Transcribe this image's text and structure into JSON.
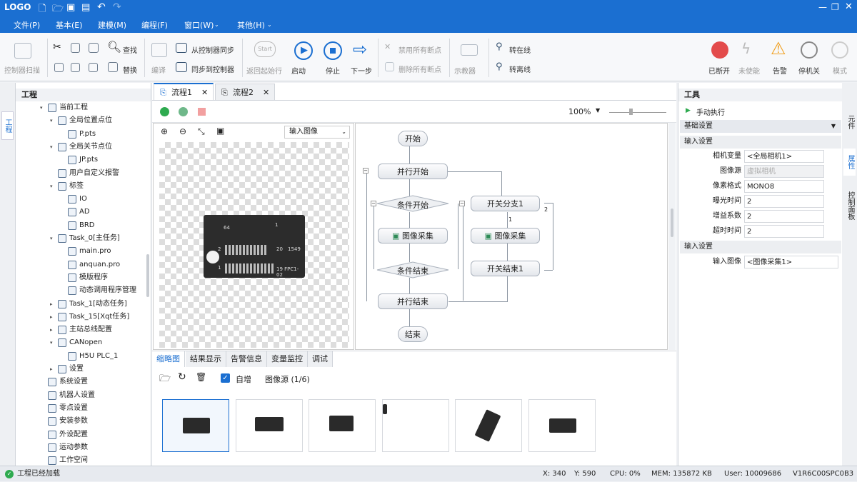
{
  "app": {
    "logo": "LOGO"
  },
  "menu": [
    "文件(P)",
    "基本(E)",
    "建模(M)",
    "编程(F)",
    "窗口(W)",
    "其他(H)"
  ],
  "ribbon": {
    "scan": "控制器扫描",
    "find": "查找",
    "replace": "替换",
    "compile": "编译",
    "sync_from": "从控制器同步",
    "sync_to": "同步到控制器",
    "start_icon_text": "Start",
    "back_start": "返回起始行",
    "run": "启动",
    "stop": "停止",
    "next": "下一步",
    "disable_bp": "禁用所有断点",
    "delete_bp": "删除所有断点",
    "teach": "示教器",
    "online": "转在线",
    "offline": "转离线",
    "disconnected": "已断开",
    "not_enabled": "未使能",
    "alarm": "告警",
    "stopped": "停机关",
    "mode": "模式"
  },
  "left_panel": {
    "title": "工程",
    "strip_label": "工程",
    "tree": [
      {
        "label": "当前工程",
        "level": 0
      },
      {
        "label": "全局位置点位",
        "level": 1
      },
      {
        "label": "P.pts",
        "level": 2
      },
      {
        "label": "全局关节点位",
        "level": 1
      },
      {
        "label": "JP.pts",
        "level": 2
      },
      {
        "label": "用户自定义报警",
        "level": 1
      },
      {
        "label": "标签",
        "level": 1
      },
      {
        "label": "IO",
        "level": 2
      },
      {
        "label": "AD",
        "level": 2
      },
      {
        "label": "BRD",
        "level": 2
      },
      {
        "label": "Task_0[主任务]",
        "level": 1
      },
      {
        "label": "main.pro",
        "level": 2
      },
      {
        "label": "anquan.pro",
        "level": 2
      },
      {
        "label": "模版程序",
        "level": 2
      },
      {
        "label": "动态调用程序管理",
        "level": 2
      },
      {
        "label": "Task_1[动态任务]",
        "level": 1
      },
      {
        "label": "Task_15[Xqt任务]",
        "level": 1
      },
      {
        "label": "主站总线配置",
        "level": 1
      },
      {
        "label": "CANopen",
        "level": 1
      },
      {
        "label": "H5U PLC_1",
        "level": 2
      },
      {
        "label": "设置",
        "level": 1
      },
      {
        "label": "系统设置",
        "level": 0
      },
      {
        "label": "机器人设置",
        "level": 0
      },
      {
        "label": "零点设置",
        "level": 0
      },
      {
        "label": "安装参数",
        "level": 0
      },
      {
        "label": "外设配置",
        "level": 0
      },
      {
        "label": "运动参数",
        "level": 0
      },
      {
        "label": "工作空间",
        "level": 0
      }
    ]
  },
  "tabs": [
    "流程1",
    "流程2"
  ],
  "zoom": "100%",
  "image_select": "输入图像",
  "board": {
    "n64": "64",
    "n1a": "1",
    "n2": "2",
    "n1b": "1",
    "n20": "20",
    "n1549": "1549",
    "code": "19 FPC1-02"
  },
  "flow": {
    "start": "开始",
    "parallel_start": "并行开始",
    "cond_start": "条件开始",
    "switch": "开关分支1",
    "capture1": "图像采集",
    "capture2": "图像采集",
    "cond_end": "条件结束",
    "switch_end": "开关结束1",
    "parallel_end": "并行结束",
    "end": "结束",
    "lbl1": "1",
    "lbl2": "2"
  },
  "bottom": {
    "tabs": [
      "缩略图",
      "结果显示",
      "告警信息",
      "变量监控",
      "调试"
    ],
    "auto_inc": "自增",
    "image_source": "图像源  (1/6)"
  },
  "right_panel": {
    "title": "工具",
    "manual": "手动执行",
    "basic": "基础设置",
    "input_settings": "输入设置",
    "input_settings2": "输入设置",
    "rows": [
      {
        "label": "相机变量",
        "value": "<全局相机1>"
      },
      {
        "label": "图像源",
        "value": "虚拟相机"
      },
      {
        "label": "像素格式",
        "value": "MONO8"
      },
      {
        "label": "曝光时间",
        "value": "2"
      },
      {
        "label": "增益系数",
        "value": "2"
      },
      {
        "label": "超时时间",
        "value": "2"
      }
    ],
    "input_image_label": "输入图像",
    "input_image_value": "<图像采集1>"
  },
  "right_strip": [
    "元件",
    "属性",
    "控制面板"
  ],
  "status": {
    "loaded": "工程已经加载",
    "x": "X: 340",
    "y": "Y: 590",
    "cpu": "CPU: 0%",
    "mem": "MEM: 135872 KB",
    "user": "User: 10009686",
    "version": "V1R6C00SPC0B3"
  }
}
